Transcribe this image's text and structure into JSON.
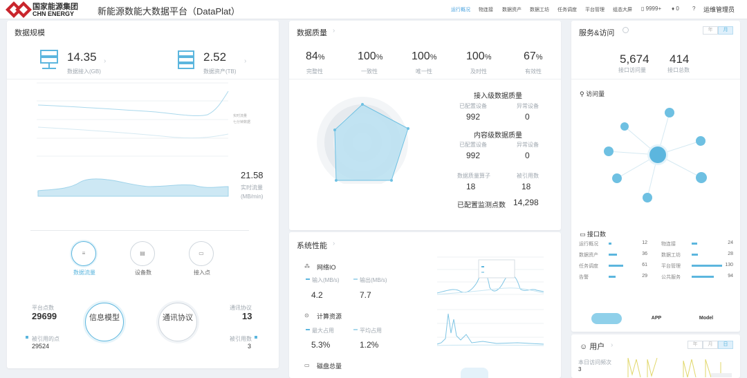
{
  "header": {
    "brand_cn": "国家能源集团",
    "brand_en": "CHN ENERGY",
    "app_title": "新能源数能大数据平台（DataPlat）",
    "nav": [
      {
        "label": "运行概况",
        "active": true
      },
      {
        "label": "物连接",
        "active": false
      },
      {
        "label": "数据资产",
        "active": false
      },
      {
        "label": "数据工坊",
        "active": false
      },
      {
        "label": "任务调度",
        "active": false
      },
      {
        "label": "平台管理",
        "active": false
      },
      {
        "label": "组态大屏",
        "active": false
      }
    ],
    "notifications": "9999+",
    "messages": "0",
    "help": "?",
    "user": "运维管理员"
  },
  "data_scale": {
    "title": "数据规模",
    "access": {
      "value": "14.35",
      "label": "数据接入(GB)"
    },
    "assets": {
      "value": "2.52",
      "label": "数据资产(TB)"
    },
    "legend": [
      "实时流量",
      "七分钟数据"
    ],
    "realtime_value": "21.58",
    "realtime_label": "实时流量",
    "realtime_unit": "(MB/min)",
    "buttons": [
      "数据流量",
      "设备数",
      "接入点"
    ],
    "platform_points_label": "平台点数",
    "platform_points": "29699",
    "protocol_label": "通讯协议",
    "protocol_value": "13",
    "referenced_points_label": "被引用的点",
    "referenced_points": "29524",
    "referenced_count_label": "被引用数",
    "referenced_count": "3",
    "info_model": "信息模型",
    "comm_protocol": "通讯协议"
  },
  "data_quality": {
    "title": "数据质量",
    "metrics": [
      {
        "value": "84",
        "label": "完整性"
      },
      {
        "value": "100",
        "label": "一致性"
      },
      {
        "value": "100",
        "label": "唯一性"
      },
      {
        "value": "100",
        "label": "及时性"
      },
      {
        "value": "67",
        "label": "有效性"
      }
    ],
    "unit": "%",
    "access_title": "接入级数据质量",
    "configured_devices_label": "已配置设备",
    "abnormal_devices_label": "异常设备",
    "access_configured": "992",
    "access_abnormal": "0",
    "content_title": "内容级数据质量",
    "content_configured": "992",
    "content_abnormal": "0",
    "operators_label": "数据质量算子",
    "operators": "18",
    "referenced_label": "被引用数",
    "referenced": "18",
    "monitor_label": "已配置监测点数",
    "monitor_points": "14,298"
  },
  "system_perf": {
    "title": "系统性能",
    "network_title": "网络IO",
    "in_label": "输入(MB/s)",
    "in_value": "4.2",
    "out_label": "输出(MB/s)",
    "out_value": "7.7",
    "compute_title": "计算资源",
    "max_label": "最大占用",
    "max_value": "5.3%",
    "avg_label": "平均占用",
    "avg_value": "1.2%",
    "disk_title": "磁盘总量"
  },
  "service": {
    "title": "服务&访问",
    "tabs": [
      "年",
      "月"
    ],
    "api_visits": "5,674",
    "api_visits_label": "接口访问量",
    "api_total": "414",
    "api_total_label": "接口总数",
    "visits_title": "访问量",
    "interfaces_title": "接口数",
    "interfaces": [
      {
        "name": "运行概况",
        "value": 12,
        "col": 0
      },
      {
        "name": "物连接",
        "value": 24,
        "col": 1
      },
      {
        "name": "数据资产",
        "value": 36,
        "col": 0
      },
      {
        "name": "数据工坊",
        "value": 28,
        "col": 1
      },
      {
        "name": "任务调度",
        "value": 61,
        "col": 0
      },
      {
        "name": "平台管理",
        "value": 130,
        "col": 1
      },
      {
        "name": "告警",
        "value": 29,
        "col": 0
      },
      {
        "name": "公共服务",
        "value": 94,
        "col": 1
      }
    ],
    "client_tabs": [
      "",
      "APP",
      "Model"
    ],
    "user_title": "用户",
    "user_tabs": [
      "年",
      "月",
      "日"
    ],
    "today_visits_label": "本日访问频次",
    "today_visits": "3"
  },
  "colors": {
    "accent": "#5cb6de",
    "radar_fill": "#bfe3f2",
    "line": "#9fd3ea"
  }
}
